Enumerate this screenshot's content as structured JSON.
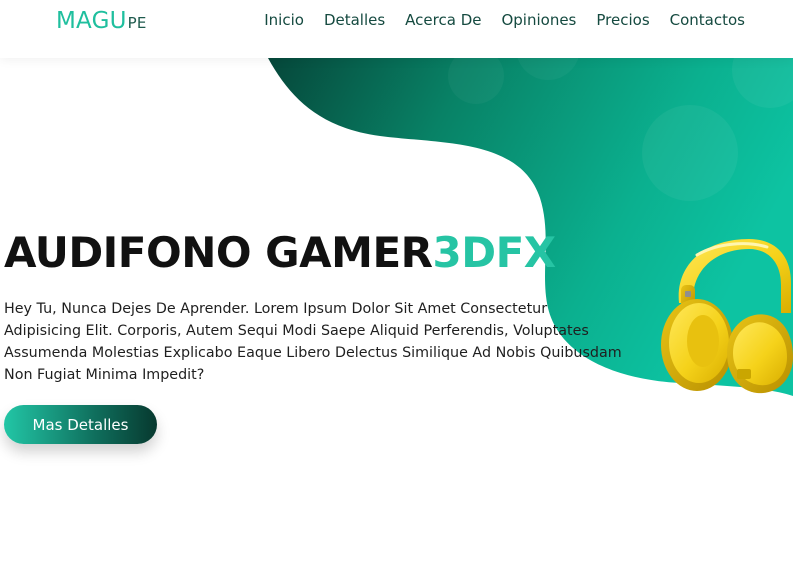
{
  "brand": {
    "main": "MAGU",
    "suffix": "PE"
  },
  "nav": {
    "items": [
      "Inicio",
      "Detalles",
      "Acerca De",
      "Opiniones",
      "Precios",
      "Contactos"
    ]
  },
  "hero": {
    "title_main": "AUDIFONO GAMER",
    "title_accent": "3DFX",
    "description": "Hey Tu, Nunca Dejes De Aprender. Lorem Ipsum Dolor Sit Amet Consectetur Adipisicing Elit. Corporis, Autem Sequi Modi Saepe Aliquid Perferendis, Voluptates Assumenda Molestias Explicabo Eaque Libero Delectus Similique Ad Nobis Quibusdam Non Fugiat Minima Impedit?",
    "button_label": "Mas Detalles",
    "product_image": "yellow-headphones"
  },
  "colors": {
    "accent": "#26c4a4",
    "dark_green": "#07392f",
    "text_nav": "#154a40",
    "headphone_yellow": "#f5d21a"
  }
}
